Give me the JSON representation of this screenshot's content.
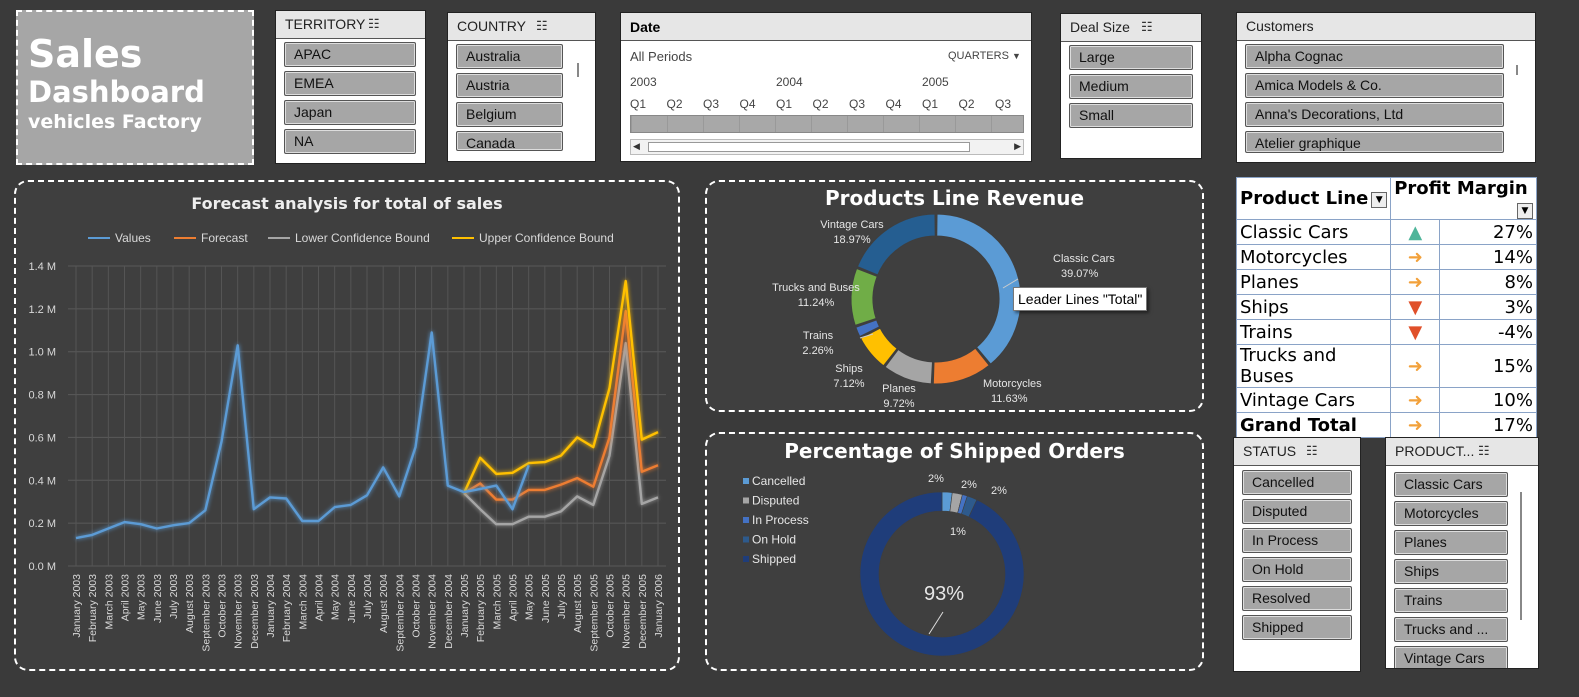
{
  "title": {
    "line1": "Sales",
    "line2": "Dashboard",
    "line3": "vehicles Factory"
  },
  "slicers": {
    "territory": {
      "header": "TERRITORY",
      "items": [
        "APAC",
        "EMEA",
        "Japan",
        "NA"
      ]
    },
    "country": {
      "header": "COUNTRY",
      "items": [
        "Australia",
        "Austria",
        "Belgium",
        "Canada"
      ]
    },
    "deal_size": {
      "header": "Deal Size",
      "items": [
        "Large",
        "Medium",
        "Small"
      ]
    },
    "customers": {
      "header": "Customers",
      "items": [
        "Alpha Cognac",
        "Amica Models & Co.",
        "Anna's Decorations, Ltd",
        "Atelier graphique"
      ]
    },
    "status": {
      "header": "STATUS",
      "items": [
        "Cancelled",
        "Disputed",
        "In Process",
        "On Hold",
        "Resolved",
        "Shipped"
      ]
    },
    "product": {
      "header": "PRODUCT...",
      "items": [
        "Classic Cars",
        "Motorcycles",
        "Planes",
        "Ships",
        "Trains",
        "Trucks and ...",
        "Vintage Cars"
      ]
    }
  },
  "date_slicer": {
    "header": "Date",
    "period_label": "All Periods",
    "level_label": "QUARTERS",
    "years": [
      "2003",
      "2004",
      "2005"
    ],
    "quarters": [
      "Q1",
      "Q2",
      "Q3",
      "Q4",
      "Q1",
      "Q2",
      "Q3",
      "Q4",
      "Q1",
      "Q2",
      "Q3"
    ]
  },
  "profit_table": {
    "headers": [
      "Product Line",
      "Profit Margin"
    ],
    "rows": [
      {
        "name": "Classic Cars",
        "trend": "up",
        "value": "27%"
      },
      {
        "name": "Motorcycles",
        "trend": "flat",
        "value": "14%"
      },
      {
        "name": "Planes",
        "trend": "flat",
        "value": "8%"
      },
      {
        "name": "Ships",
        "trend": "down",
        "value": "3%"
      },
      {
        "name": "Trains",
        "trend": "down",
        "value": "-4%"
      },
      {
        "name": "Trucks and Buses",
        "trend": "flat",
        "value": "15%"
      },
      {
        "name": "Vintage Cars",
        "trend": "flat",
        "value": "10%"
      },
      {
        "name": "Grand Total",
        "trend": "flat",
        "value": "17%"
      }
    ]
  },
  "colors": {
    "values": "#5b9bd5",
    "forecast": "#ed7d31",
    "lower": "#a5a5a5",
    "upper": "#ffc000",
    "up_arrow": "#4fb59a",
    "flat_arrow": "#f2a13b",
    "down_arrow": "#e0502a"
  },
  "chart_data": [
    {
      "type": "line",
      "title": "Forecast analysis for total of sales",
      "ylim": [
        0,
        1400000
      ],
      "y_ticks": [
        "0.0 M",
        "0.2 M",
        "0.4 M",
        "0.6 M",
        "0.8 M",
        "1.0 M",
        "1.2 M",
        "1.4 M"
      ],
      "x": [
        "January 2003",
        "February 2003",
        "March 2003",
        "April 2003",
        "May 2003",
        "June 2003",
        "July 2003",
        "August 2003",
        "September 2003",
        "October 2003",
        "November 2003",
        "December 2003",
        "January 2004",
        "February 2004",
        "March 2004",
        "April 2004",
        "May 2004",
        "June 2004",
        "July 2004",
        "August 2004",
        "September 2004",
        "October 2004",
        "November 2004",
        "December 2004",
        "January 2005",
        "February 2005",
        "March 2005",
        "April 2005",
        "May 2005",
        "June 2005",
        "July 2005",
        "August 2005",
        "September 2005",
        "October 2005",
        "November 2005",
        "December 2005",
        "January 2006"
      ],
      "legend": [
        "Values",
        "Forecast",
        "Lower Confidence Bound",
        "Upper Confidence Bound"
      ],
      "series": [
        {
          "name": "Values",
          "values": [
            130000,
            145000,
            175000,
            205000,
            195000,
            175000,
            190000,
            200000,
            260000,
            580000,
            1030000,
            265000,
            320000,
            315000,
            210000,
            210000,
            275000,
            285000,
            330000,
            460000,
            325000,
            555000,
            1090000,
            375000,
            345000,
            360000,
            375000,
            265000,
            470000,
            null,
            null,
            null,
            null,
            null,
            null,
            null,
            null
          ]
        },
        {
          "name": "Forecast",
          "values": [
            null,
            null,
            null,
            null,
            null,
            null,
            null,
            null,
            null,
            null,
            null,
            null,
            null,
            null,
            null,
            null,
            null,
            null,
            null,
            null,
            null,
            null,
            null,
            null,
            340000,
            385000,
            310000,
            310000,
            355000,
            355000,
            380000,
            410000,
            370000,
            600000,
            1190000,
            440000,
            470000
          ]
        },
        {
          "name": "Lower Confidence Bound",
          "values": [
            null,
            null,
            null,
            null,
            null,
            null,
            null,
            null,
            null,
            null,
            null,
            null,
            null,
            null,
            null,
            null,
            null,
            null,
            null,
            null,
            null,
            null,
            null,
            null,
            340000,
            265000,
            195000,
            195000,
            230000,
            230000,
            255000,
            325000,
            285000,
            515000,
            1040000,
            290000,
            320000
          ]
        },
        {
          "name": "Upper Confidence Bound",
          "values": [
            null,
            null,
            null,
            null,
            null,
            null,
            null,
            null,
            null,
            null,
            null,
            null,
            null,
            null,
            null,
            null,
            null,
            null,
            null,
            null,
            null,
            null,
            null,
            null,
            340000,
            505000,
            430000,
            435000,
            480000,
            485000,
            515000,
            600000,
            555000,
            830000,
            1330000,
            590000,
            625000
          ]
        }
      ]
    },
    {
      "type": "pie",
      "title": "Products Line Revenue",
      "categories": [
        "Classic Cars",
        "Motorcycles",
        "Planes",
        "Ships",
        "Trains",
        "Trucks and Buses",
        "Vintage Cars"
      ],
      "values": [
        39.07,
        11.63,
        9.72,
        7.12,
        2.26,
        11.24,
        18.97
      ],
      "labels": [
        "39.07%",
        "11.63%",
        "9.72%",
        "7.12%",
        "2.26%",
        "11.24%",
        "18.97%"
      ],
      "colors": [
        "#5b9bd5",
        "#ed7d31",
        "#a5a5a5",
        "#ffc000",
        "#4472c4",
        "#70ad47",
        "#255e91"
      ],
      "callout": "Leader Lines \"Total\""
    },
    {
      "type": "pie",
      "title": "Percentage of Shipped Orders",
      "categories": [
        "Cancelled",
        "Disputed",
        "In Process",
        "On Hold",
        "Shipped"
      ],
      "values": [
        2,
        2,
        1,
        2,
        93
      ],
      "labels": [
        "2%",
        "2%",
        "1%",
        "2%",
        "93%"
      ],
      "colors": [
        "#5b9bd5",
        "#a5a5a5",
        "#4472c4",
        "#2e5a8c",
        "#1f3d7a"
      ]
    }
  ]
}
